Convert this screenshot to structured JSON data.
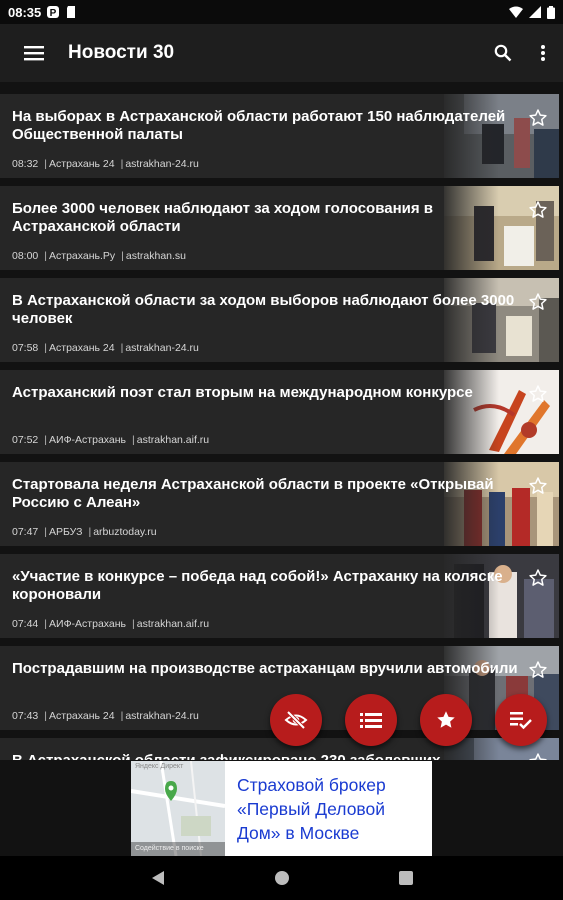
{
  "status_bar": {
    "time": "08:35"
  },
  "app_bar": {
    "title": "Новости 30"
  },
  "articles": [
    {
      "title": "На выборах в Астраханской области работают 150 наблюдателей Общественной палаты",
      "time": "08:32",
      "source": "Астрахань 24",
      "domain": "astrakhan-24.ru"
    },
    {
      "title": "Более 3000 человек наблюдают за ходом голосования в Астраханской области",
      "time": "08:00",
      "source": "Астрахань.Ру",
      "domain": "astrakhan.su"
    },
    {
      "title": "В Астраханской области за ходом выборов наблюдают более 3000 человек",
      "time": "07:58",
      "source": "Астрахань 24",
      "domain": "astrakhan-24.ru"
    },
    {
      "title": "Астраханский поэт стал вторым на международном конкурсе",
      "time": "07:52",
      "source": "АИФ-Астрахань",
      "domain": "astrakhan.aif.ru"
    },
    {
      "title": "Стартовала неделя Астраханской области в проекте «Открывай Россию с Алеан»",
      "time": "07:47",
      "source": "АРБУЗ",
      "domain": "arbuztoday.ru"
    },
    {
      "title": "«Участие в конкурсе – победа над собой!» Астраханку на коляске короновали",
      "time": "07:44",
      "source": "АИФ-Астрахань",
      "domain": "astrakhan.aif.ru"
    },
    {
      "title": "Пострадавшим на производстве астраханцам вручили автомобили",
      "time": "07:43",
      "source": "Астрахань 24",
      "domain": "astrakhan-24.ru"
    },
    {
      "title": "В Астраханской области зафиксировано 230 заболевших",
      "time": "",
      "source": "",
      "domain": ""
    }
  ],
  "ad": {
    "text": "Страховой брокер «Первый Деловой Дом» в Москве",
    "map_top_caption": "Яндекс Директ",
    "map_bottom_caption": "Содействие в поиске"
  },
  "colors": {
    "accent": "#b71c1c",
    "card": "#262626",
    "background": "#121212",
    "ad_text": "#1a3bd1"
  },
  "fab_icons": [
    "eye-off-icon",
    "list-icon",
    "star-icon",
    "playlist-check-icon"
  ]
}
